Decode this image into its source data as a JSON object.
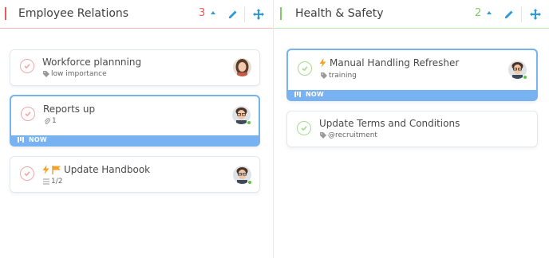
{
  "columns": [
    {
      "title": "Employee Relations",
      "count": "3",
      "accent": "#ec5b5b",
      "cards": [
        {
          "title": "Workforce plannning",
          "meta": "low importance",
          "meta_icon": "tag-icon",
          "check_color": "#f2a7a7",
          "now": false
        },
        {
          "title": "Reports up",
          "meta": "1",
          "meta_icon": "paperclip-icon",
          "check_color": "#f2a7a7",
          "now": true,
          "now_label": "NOW"
        },
        {
          "title": "Update Handbook",
          "meta": "1/2",
          "meta_icon": "checklist-icon",
          "check_color": "#f2a7a7",
          "now": false,
          "prefix_icons": [
            "lightning-icon",
            "flag-icon"
          ]
        }
      ]
    },
    {
      "title": "Health & Safety",
      "count": "2",
      "accent": "#7ccc62",
      "cards": [
        {
          "title": "Manual Handling Refresher",
          "meta": "training",
          "meta_icon": "tag-icon",
          "check_color": "#a6dc92",
          "now": true,
          "now_label": "NOW",
          "prefix_icons": [
            "lightning-icon"
          ]
        },
        {
          "title": "Update Terms and Conditions",
          "meta": "@recruitment",
          "meta_icon": "tag-icon",
          "check_color": "#a6dc92",
          "now": false
        }
      ]
    }
  ],
  "colors": {
    "accent_blue": "#2f9ad8",
    "now_strip": "#78b2f0",
    "online": "#5cc24c"
  }
}
